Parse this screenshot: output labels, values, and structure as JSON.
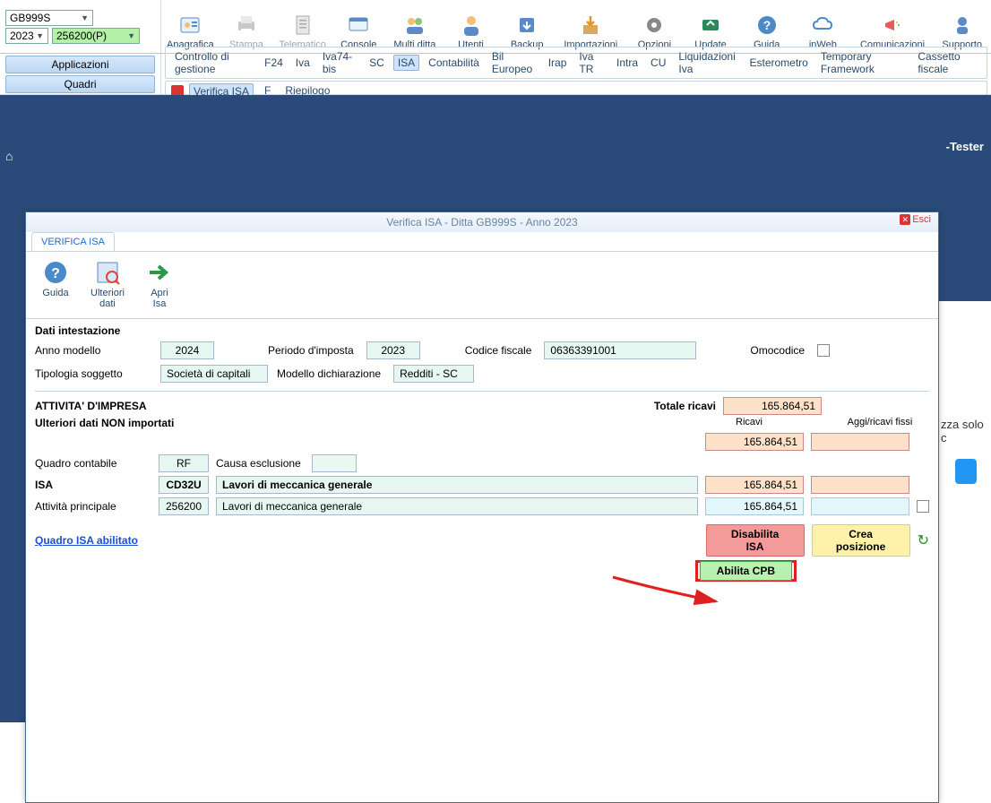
{
  "topbar": {
    "company": "GB999S",
    "year": "2023",
    "code": "256200(P)"
  },
  "ribbon": [
    {
      "label": "Anagrafica"
    },
    {
      "label": "Stampa",
      "disabled": true
    },
    {
      "label": "Telematico",
      "disabled": true
    },
    {
      "label": "Console"
    },
    {
      "label": "Multi ditta"
    },
    {
      "label": "Utenti"
    },
    {
      "label": "Backup"
    },
    {
      "label": "Importazioni"
    },
    {
      "label": "Opzioni"
    },
    {
      "label": "Update"
    },
    {
      "label": "Guida"
    },
    {
      "label": "inWeb"
    },
    {
      "label": "Comunicazioni"
    },
    {
      "label": "Supporto"
    }
  ],
  "leftButtons": {
    "applicazioni": "Applicazioni",
    "quadri": "Quadri"
  },
  "tabStrip1": [
    "Controllo di gestione",
    "F24",
    "Iva",
    "Iva74-bis",
    "SC",
    "ISA",
    "Contabilità",
    "Bil Europeo",
    "Irap",
    "Iva TR",
    "Intra",
    "CU",
    "Liquidazioni Iva",
    "Esterometro",
    "Temporary Framework",
    "Cassetto fiscale"
  ],
  "tabStrip1Active": "ISA",
  "tabStrip2": [
    "Verifica ISA",
    "F",
    "Riepilogo"
  ],
  "tabStrip2Active": "Verifica ISA",
  "modal": {
    "title": "Verifica ISA - Ditta GB999S - Anno 2023",
    "esci": "Esci",
    "tab": "VERIFICA ISA",
    "toolbar": {
      "guida": "Guida",
      "ulteriori": "Ulteriori\ndati",
      "apri": "Apri\nIsa"
    },
    "sectionHeader": "Dati intestazione",
    "fields": {
      "annoModelloLabel": "Anno modello",
      "annoModello": "2024",
      "periodoLabel": "Periodo d'imposta",
      "periodo": "2023",
      "cfLabel": "Codice fiscale",
      "cf": "06363391001",
      "omocodiceLabel": "Omocodice",
      "tipologiaLabel": "Tipologia soggetto",
      "tipologia": "Società di capitali",
      "modelloLabel": "Modello dichiarazione",
      "modello": "Redditi - SC"
    },
    "activity": {
      "header": "ATTIVITA' D'IMPRESA",
      "sub": "Ulteriori dati NON importati",
      "totaleRicaviLabel": "Totale ricavi",
      "totaleRicavi": "165.864,51",
      "colRicavi": "Ricavi",
      "colAggi": "Aggi/ricavi fissi",
      "ricaviVal": "165.864,51",
      "quadroContLabel": "Quadro contabile",
      "quadroCont": "RF",
      "causaEsclLabel": "Causa esclusione",
      "causaEscl": "",
      "isaLabel": "ISA",
      "isaCode": "CD32U",
      "isaDesc": "Lavori di meccanica generale",
      "isaRicavi": "165.864,51",
      "attPrincLabel": "Attività principale",
      "attPrincCode": "256200",
      "attPrincDesc": "Lavori di meccanica generale",
      "attPrincRicavi": "165.864,51",
      "link": "Quadro ISA abilitato",
      "btnDisabilita": "Disabilita ISA",
      "btnCrea": "Crea posizione",
      "btnAbilita": "Abilita CPB"
    }
  },
  "side": {
    "tester": "-Tester",
    "text": "zza solo c"
  }
}
